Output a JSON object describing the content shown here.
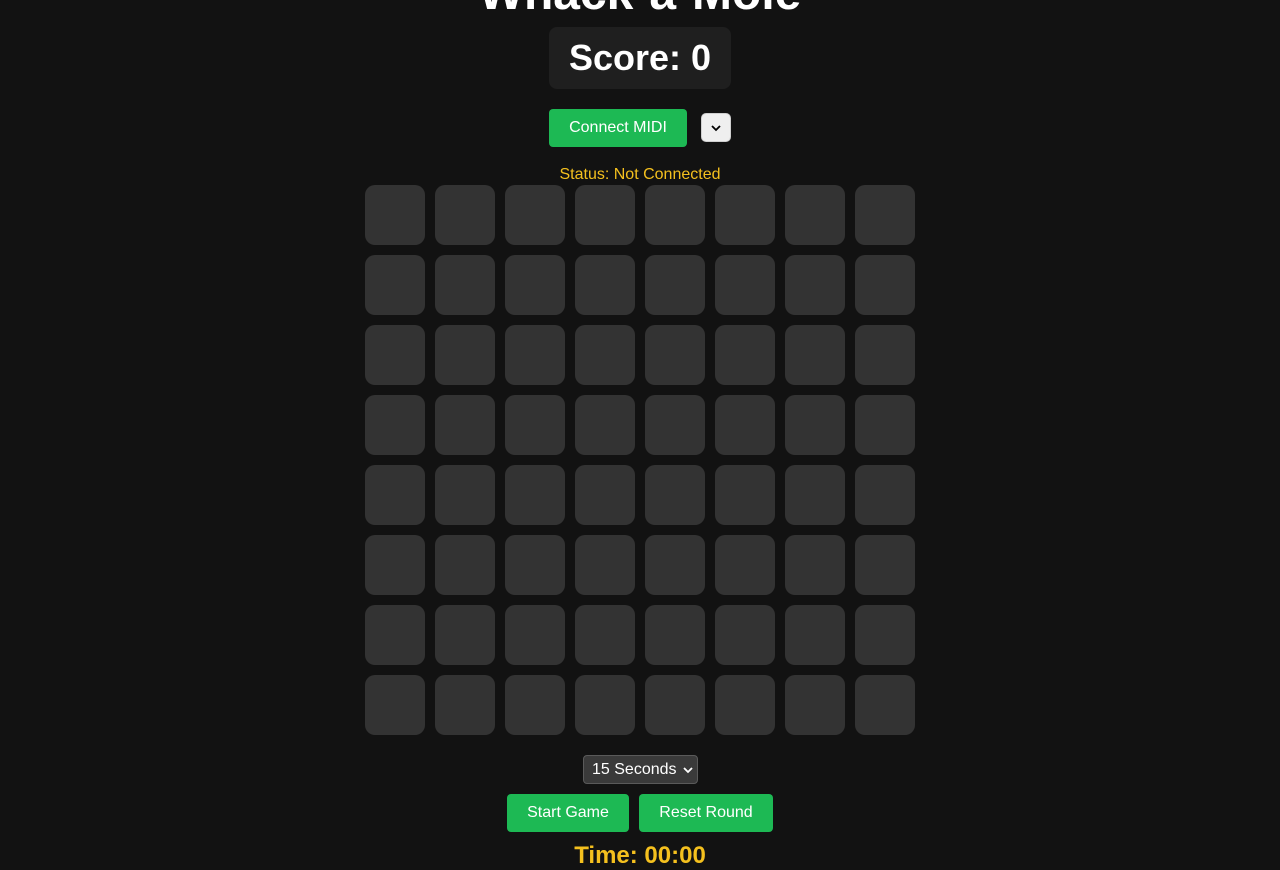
{
  "game": {
    "title": "Whack-a-Mole",
    "score_text": "Score: 0",
    "status_text": "Status: Not Connected",
    "time_text": "Time: 00:00"
  },
  "midi": {
    "connect_label": "Connect MIDI",
    "device_selected": ""
  },
  "controls": {
    "duration_selected": "15 Seconds",
    "start_label": "Start Game",
    "reset_label": "Reset Round"
  },
  "board": {
    "rows": 8,
    "cols": 8
  },
  "colors": {
    "background": "#121212",
    "accent_green": "#1db954",
    "status_yellow": "#f4c01e",
    "cell": "#333333"
  }
}
